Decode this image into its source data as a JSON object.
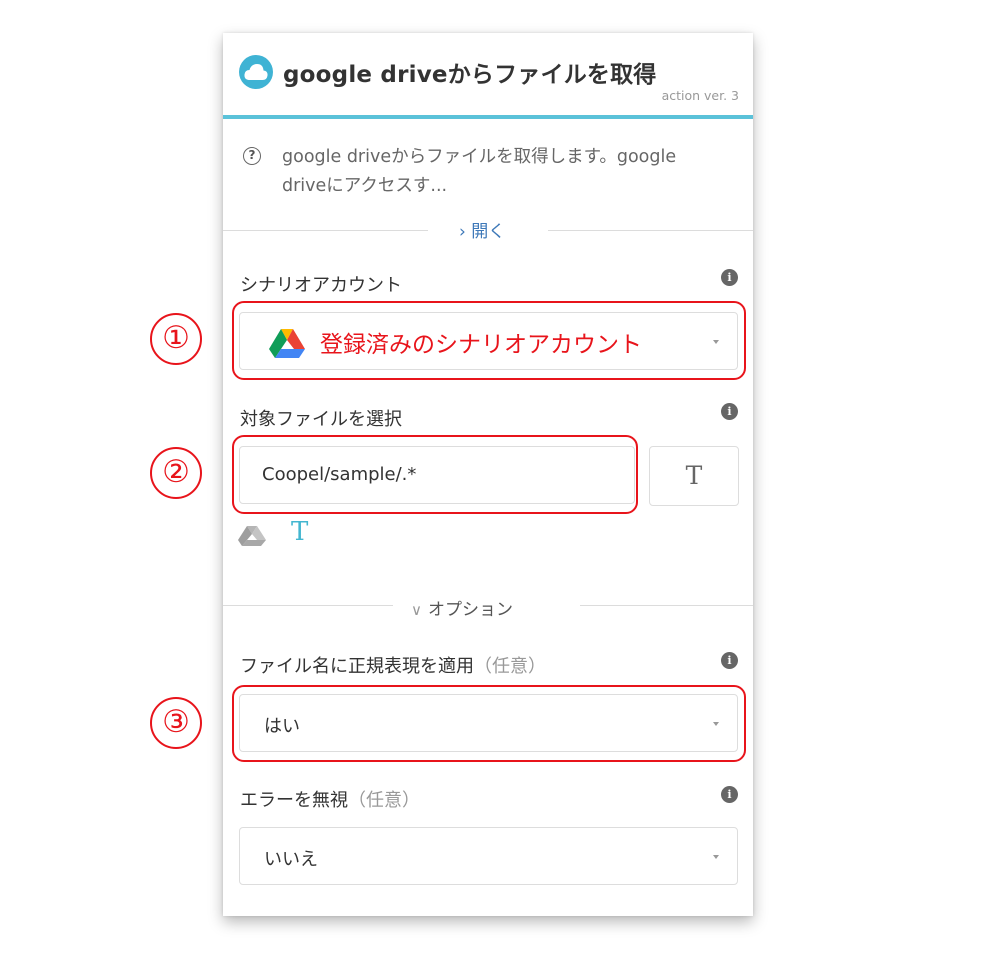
{
  "header": {
    "title": "google driveからファイルを取得",
    "version": "action ver. 3",
    "icon": "cloud-icon"
  },
  "description": {
    "text": "google driveからファイルを取得します。google driveにアクセスす...",
    "open_label": "› 開く",
    "icon": "help-icon"
  },
  "fields": {
    "account": {
      "label": "シナリオアカウント",
      "value": "登録済みのシナリオアカウント",
      "icon": "google-drive-icon"
    },
    "target_file": {
      "label": "対象ファイルを選択",
      "value": "Coopel/sample/.*",
      "text_mode_label": "T"
    },
    "options_label": "オプション",
    "regex": {
      "label": "ファイル名に正規表現を適用",
      "optional": "（任意）",
      "value": "はい"
    },
    "ignore_error": {
      "label": "エラーを無視",
      "optional": "（任意）",
      "value": "いいえ"
    }
  },
  "annotations": {
    "one": "①",
    "two": "②",
    "three": "③",
    "color": "#e8141b"
  },
  "colors": {
    "accent": "#5bc2d9",
    "link": "#3d78b8"
  }
}
